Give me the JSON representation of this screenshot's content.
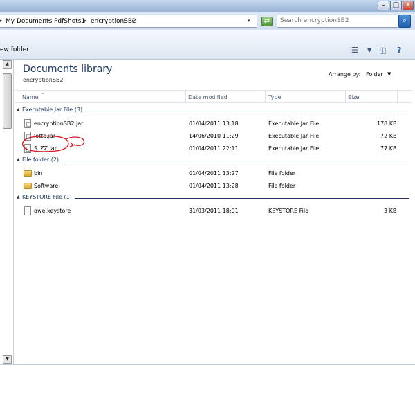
{
  "window": {
    "minimize_glyph": "–",
    "maximize_glyph": "□",
    "close_glyph": "✕"
  },
  "address": {
    "breadcrumbs": [
      "My Documents",
      "PdfShots1",
      "encryptionSB2"
    ],
    "separator": "▸",
    "dropdown_glyph": "▾"
  },
  "search": {
    "placeholder": "Search encryptionSB2"
  },
  "toolbar": {
    "new_folder_label": "ew folder"
  },
  "library": {
    "title": "Documents library",
    "subtitle": "encryptionSB2",
    "arrange_label": "Arrange by:",
    "arrange_value": "Folder"
  },
  "columns": {
    "name": "Name",
    "name_sort": "˄",
    "date": "Date modified",
    "type": "Type",
    "size": "Size"
  },
  "groups": [
    {
      "label": "Executable Jar File (3)",
      "files": [
        {
          "name": "encryptionSB2.jar",
          "date": "01/04/2011 13:18",
          "type": "Executable Jar File",
          "size": "178 KB"
        },
        {
          "name": "lotto.jar",
          "date": "14/06/2010 11:29",
          "type": "Executable Jar File",
          "size": "72 KB"
        },
        {
          "name": "S_ZZ.jar",
          "date": "01/04/2011 22:11",
          "type": "Executable Jar File",
          "size": "77 KB"
        }
      ]
    },
    {
      "label": "File folder (2)",
      "files": [
        {
          "name": "bin",
          "date": "01/04/2011 13:27",
          "type": "File folder",
          "size": ""
        },
        {
          "name": "Software",
          "date": "01/04/2011 13:28",
          "type": "File folder",
          "size": ""
        }
      ]
    },
    {
      "label": "KEYSTORE File (1)",
      "files": [
        {
          "name": "qwe.keystore",
          "date": "31/03/2011 18:01",
          "type": "KEYSTORE File",
          "size": "3 KB"
        }
      ]
    }
  ],
  "annotation_color": "#e0101a"
}
